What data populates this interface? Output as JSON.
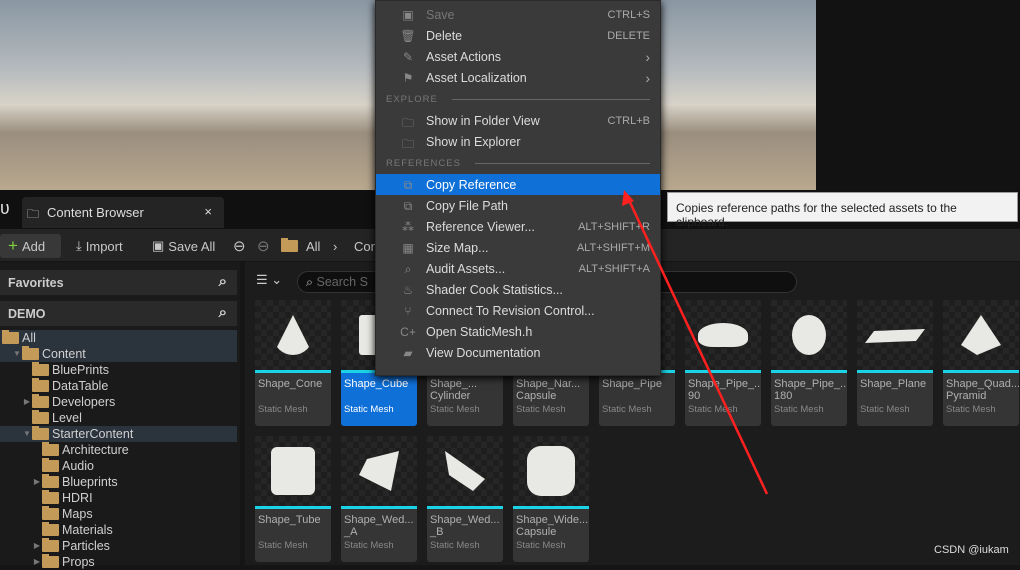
{
  "tab": {
    "title": "Content Browser",
    "close": "×"
  },
  "toolbar": {
    "add": "Add",
    "import": "Import",
    "save_all": "Save All",
    "path": [
      "All",
      "Con"
    ]
  },
  "sidebar": {
    "favorites": "Favorites",
    "project": "DEMO",
    "tree": [
      {
        "label": "All",
        "depth": 0,
        "sel": true,
        "open": true
      },
      {
        "label": "Content",
        "depth": 1,
        "sel": true,
        "arrow": "open"
      },
      {
        "label": "BluePrints",
        "depth": 2
      },
      {
        "label": "DataTable",
        "depth": 2
      },
      {
        "label": "Developers",
        "depth": 2,
        "arrow": "closed"
      },
      {
        "label": "Level",
        "depth": 2
      },
      {
        "label": "StarterContent",
        "depth": 2,
        "sel": true,
        "arrow": "open"
      },
      {
        "label": "Architecture",
        "depth": 3
      },
      {
        "label": "Audio",
        "depth": 3
      },
      {
        "label": "Blueprints",
        "depth": 3,
        "arrow": "closed"
      },
      {
        "label": "HDRI",
        "depth": 3
      },
      {
        "label": "Maps",
        "depth": 3
      },
      {
        "label": "Materials",
        "depth": 3
      },
      {
        "label": "Particles",
        "depth": 3,
        "arrow": "closed"
      },
      {
        "label": "Props",
        "depth": 3,
        "arrow": "closed"
      }
    ]
  },
  "search": {
    "placeholder": "Search S"
  },
  "assets": [
    {
      "name": "Shape_Cone",
      "type": "Static Mesh"
    },
    {
      "name": "Shape_Cube",
      "type": "Static Mesh",
      "selected": true
    },
    {
      "name": "Shape_...\nCylinder",
      "type": "Static Mesh"
    },
    {
      "name": "Shape_Nar...\nCapsule",
      "type": "Static Mesh"
    },
    {
      "name": "Shape_Pipe",
      "type": "Static Mesh"
    },
    {
      "name": "Shape_Pipe_...\n90",
      "type": "Static Mesh"
    },
    {
      "name": "Shape_Pipe_...\n180",
      "type": "Static Mesh"
    },
    {
      "name": "Shape_Plane",
      "type": "Static Mesh"
    },
    {
      "name": "Shape_Quad...\nPyramid",
      "type": "Static Mesh"
    },
    {
      "name": "Shape_Tube",
      "type": "Static Mesh"
    },
    {
      "name": "Shape_Wed...\n_A",
      "type": "Static Mesh"
    },
    {
      "name": "Shape_Wed...\n_B",
      "type": "Static Mesh"
    },
    {
      "name": "Shape_Wide...\nCapsule",
      "type": "Static Mesh"
    }
  ],
  "menu": [
    {
      "label": "Save",
      "shortcut": "CTRL+S",
      "icon": "save-icon",
      "disabled": true
    },
    {
      "label": "Delete",
      "shortcut": "DELETE",
      "icon": "trash-icon"
    },
    {
      "label": "Asset Actions",
      "submenu": true,
      "icon": "wrench-icon"
    },
    {
      "label": "Asset Localization",
      "submenu": true,
      "icon": "flag-icon"
    },
    {
      "section": "EXPLORE"
    },
    {
      "label": "Show in Folder View",
      "shortcut": "CTRL+B",
      "icon": "folder-search-icon"
    },
    {
      "label": "Show in Explorer",
      "icon": "folder-search-icon"
    },
    {
      "section": "REFERENCES"
    },
    {
      "label": "Copy Reference",
      "icon": "copy-icon",
      "highlighted": true
    },
    {
      "label": "Copy File Path",
      "icon": "copy-icon"
    },
    {
      "label": "Reference Viewer...",
      "shortcut": "ALT+SHIFT+R",
      "icon": "graph-icon"
    },
    {
      "label": "Size Map...",
      "shortcut": "ALT+SHIFT+M",
      "icon": "size-map-icon"
    },
    {
      "label": "Audit Assets...",
      "shortcut": "ALT+SHIFT+A",
      "icon": "audit-icon"
    },
    {
      "label": "Shader Cook Statistics...",
      "icon": "bowl-icon"
    },
    {
      "label": "Connect To Revision Control...",
      "icon": "branch-icon"
    },
    {
      "label": "Open StaticMesh.h",
      "icon": "cpp-icon"
    },
    {
      "label": "View Documentation",
      "icon": "book-icon"
    }
  ],
  "tooltip": "Copies reference paths for the selected assets to the clipboard.",
  "watermark": "CSDN @iukam",
  "colors": {
    "accent": "#0f70d8",
    "thumb_underline": "#1ad3e6",
    "folder": "#c49a58",
    "annotation_arrow": "#ff2020"
  }
}
